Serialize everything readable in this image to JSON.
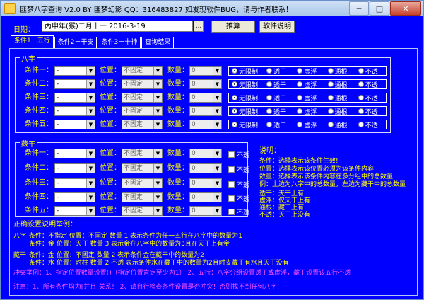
{
  "window": {
    "title": "匪梦八字查询 V2.0 BY 匪梦幻影 QQ：316483827 如发现软件BUG，请与作者联系！",
    "min": "─",
    "max": "□",
    "close": "✕"
  },
  "date": {
    "label": "日期：",
    "value": "丙申年(猴)二月十一  2016-3-19",
    "dots": "...",
    "search": "推算",
    "help": "软件说明"
  },
  "tabs": [
    "条件1－五行",
    "条件2－干支",
    "条件3－十神",
    "查询结果"
  ],
  "bazi": {
    "title": "八字",
    "rows": [
      {
        "label": "条件一：",
        "cond": "-",
        "pos_label": "位置：",
        "pos": "不固定",
        "num_label": "数量：",
        "num": "0"
      },
      {
        "label": "条件二：",
        "cond": "-",
        "pos_label": "位置：",
        "pos": "不固定",
        "num_label": "数量：",
        "num": "0"
      },
      {
        "label": "条件三：",
        "cond": "-",
        "pos_label": "位置：",
        "pos": "不固定",
        "num_label": "数量：",
        "num": "0"
      },
      {
        "label": "条件四：",
        "cond": "-",
        "pos_label": "位置：",
        "pos": "不固定",
        "num_label": "数量：",
        "num": "0"
      },
      {
        "label": "条件五：",
        "cond": "-",
        "pos_label": "位置：",
        "pos": "不固定",
        "num_label": "数量：",
        "num": "0"
      }
    ],
    "radios": [
      "无限制",
      "透干",
      "虚浮",
      "通根",
      "不透"
    ]
  },
  "canggan": {
    "title": "藏干",
    "rows": [
      {
        "label": "条件一：",
        "cond": "-",
        "pos_label": "位置：",
        "pos": "不固定",
        "num_label": "数量：",
        "num": "0",
        "check": "不透"
      },
      {
        "label": "条件二：",
        "cond": "-",
        "pos_label": "位置：",
        "pos": "不固定",
        "num_label": "数量：",
        "num": "0",
        "check": "不透"
      },
      {
        "label": "条件三：",
        "cond": "-",
        "pos_label": "位置：",
        "pos": "不固定",
        "num_label": "数量：",
        "num": "0",
        "check": "不透"
      },
      {
        "label": "条件四：",
        "cond": "-",
        "pos_label": "位置：",
        "pos": "不固定",
        "num_label": "数量：",
        "num": "0",
        "check": "不透"
      },
      {
        "label": "条件五：",
        "cond": "-",
        "pos_label": "位置：",
        "pos": "不固定",
        "num_label": "数量：",
        "num": "0",
        "check": "不透"
      }
    ]
  },
  "desc": {
    "title": "说明：",
    "lines": [
      "条件：选择表示该条件生效!",
      "位置：选择表示该位置必须为该条件内容",
      "数量：选择表示该条件内容在多分组中的总数量",
      "例：上边为八字中的总数量，左边为藏干中的总数量"
    ],
    "lines2": [
      "透干：天干上有",
      "虚浮：仅天干上有",
      "通根：藏干上有",
      "不透：天干上没有"
    ]
  },
  "examples": {
    "title": "正确设置说明举例：",
    "bazi_tag": "八字",
    "bazi_lines": [
      "条件：不指定  位置：不固定  数量 1      表示条件为任一五行在八字中的数量为1",
      "条件：金      位置：天干    数量 3      表示金在八字中的数量为3且在天干上有金"
    ],
    "cg_tag": "藏干",
    "cg_lines": [
      "条件：金      位置：不固定  数量 2      表示条件金在藏干中的数量为2",
      "条件：水      位置：时柱    数量 2  不透  表示条件水在藏干中的数量为2且时支藏干有水且天干没有"
    ]
  },
  "conflict": "冲突举例：1、指定位置数量设置()（指定位置肯定至少为1）  2、五行：八字分组设置透干或虚浮，藏干设置该五行不透",
  "note": "注意：1、所有条件均为[并且]关系！  2、请自行检查条件设置是否冲突！否则找不到任何八字！"
}
